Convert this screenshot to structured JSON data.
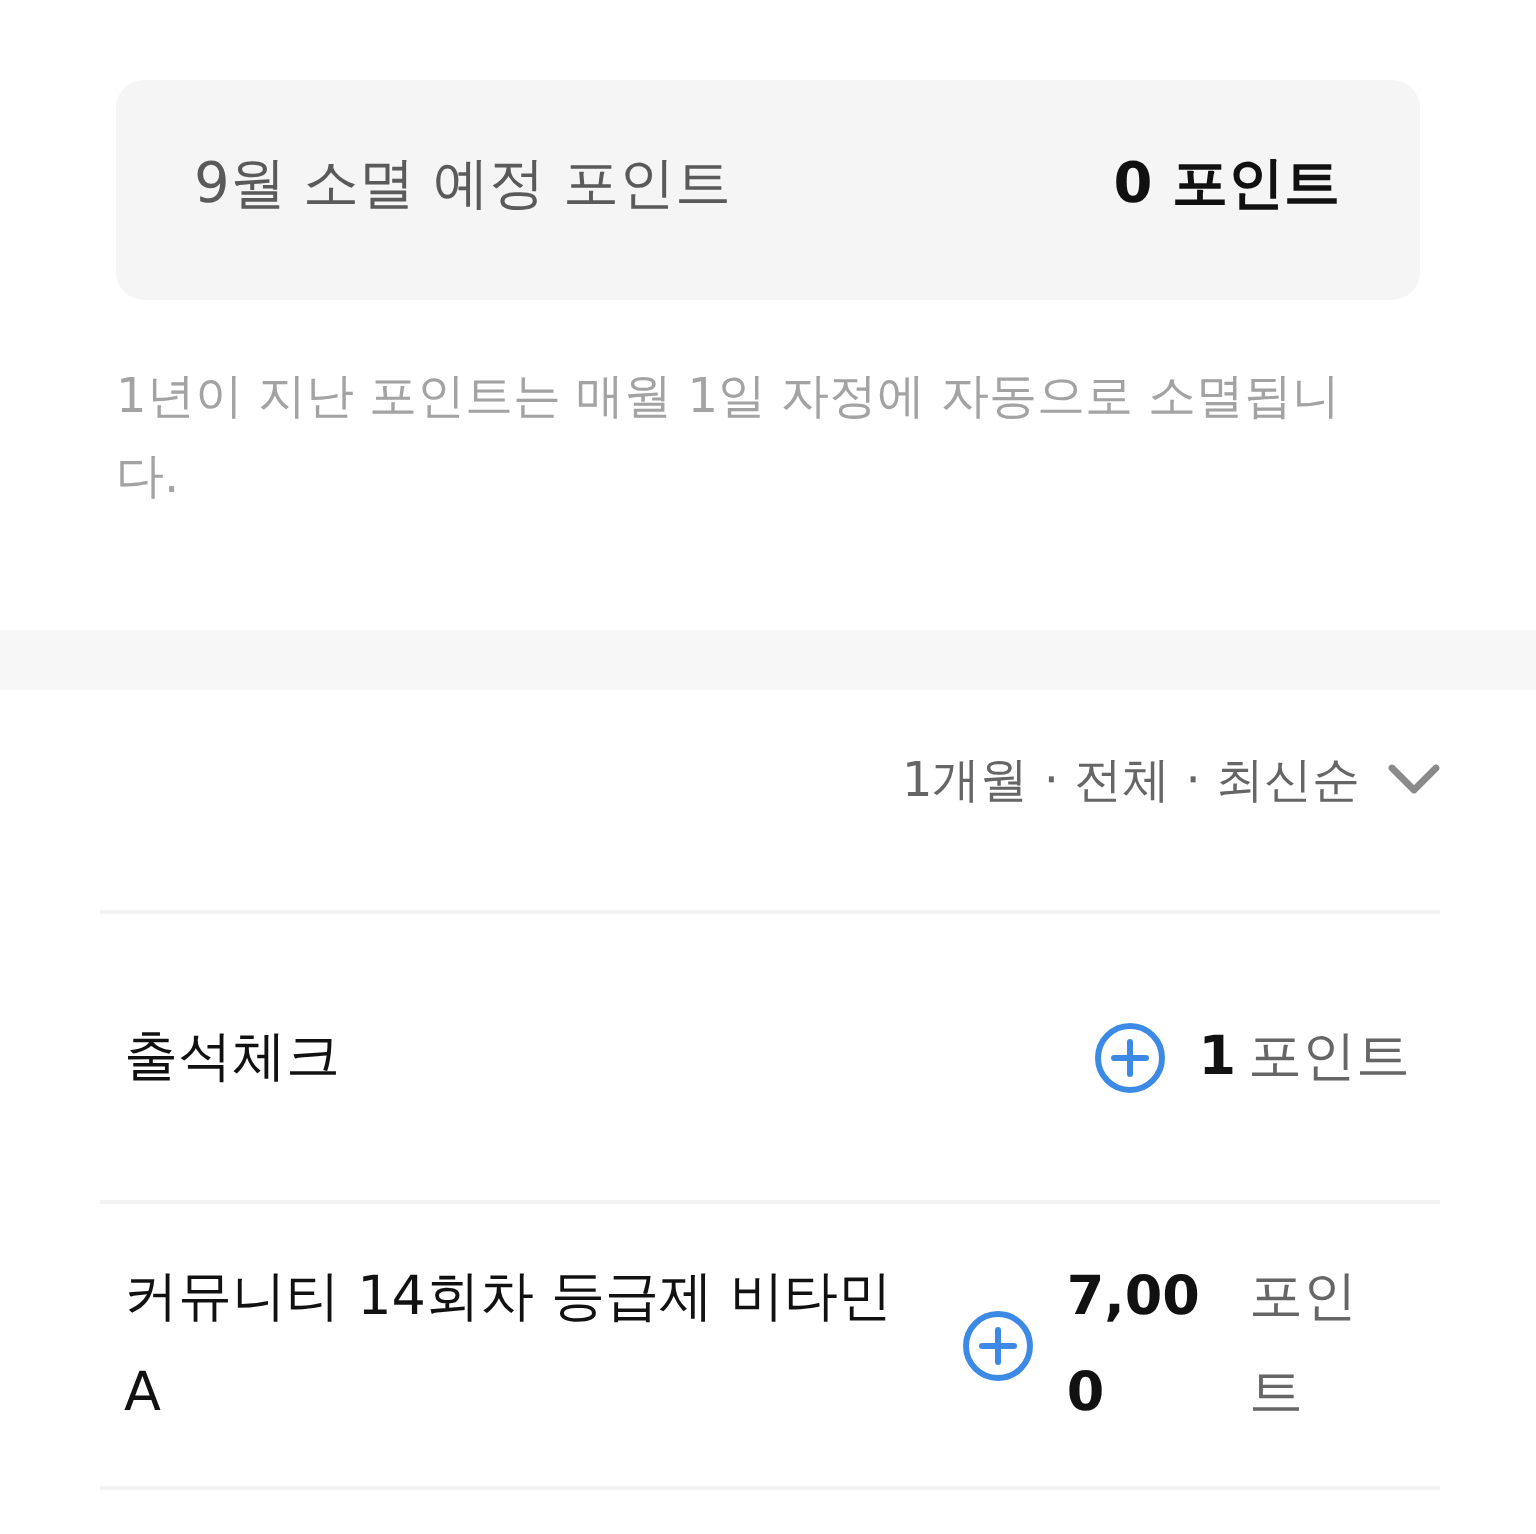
{
  "expiring": {
    "label": "9월 소멸 예정 포인트",
    "value": "0 포인트"
  },
  "notice": "1년이 지난 포인트는 매월 1일 자정에 자동으로 소멸됩니다.",
  "filter": {
    "label": "1개월 · 전체 · 최신순"
  },
  "history": [
    {
      "title": "출석체크",
      "kind": "earn",
      "amount": "1",
      "unit": "포인트"
    },
    {
      "title": "커뮤니티 14회차 등급제 비타민 A",
      "kind": "earn",
      "amount": "7,000",
      "unit": "포인트"
    }
  ]
}
